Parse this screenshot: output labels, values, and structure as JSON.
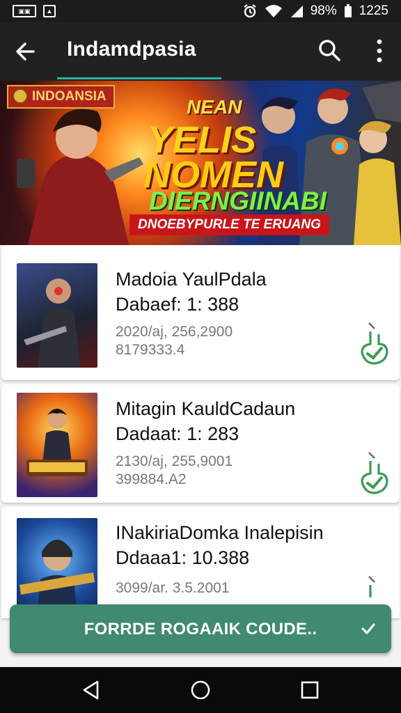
{
  "status_bar": {
    "left_icons": [
      "gallery-icon",
      "notification-icon"
    ],
    "left_icon_text": "▣▣",
    "battery": "98%",
    "time": "1225",
    "right_icons": [
      "alarm-icon",
      "wifi-icon",
      "signal-icon",
      "battery-icon"
    ]
  },
  "app_bar": {
    "title": "Indamdpasia",
    "icons": [
      "back-arrow-icon",
      "search-icon",
      "more-vert-icon"
    ],
    "accent_color": "#2bb0a4"
  },
  "banner": {
    "tag": "INDOANSIA",
    "line1": "NEAN",
    "line2": "YELIS",
    "line3": "NOMEN",
    "line4": "DIERNGIINABI",
    "line5": "DNOEBYPURLE TE ERUANG"
  },
  "items": [
    {
      "name": "Madoia YaulPdala",
      "detail": "Dabaef: 1: 388",
      "meta1": "2020/aj, 256,2900",
      "meta2": "8179333.4"
    },
    {
      "name": "Mitagin KauldCadaun",
      "detail": "Dadaat: 1: 283",
      "meta1": "2130/aj, 255,9001",
      "meta2": "399884.A2"
    },
    {
      "name": "INakiriaDomka Inalepisin",
      "detail": "Ddaaa1: 10.388",
      "meta1": "3099/ar. 3.5.2001",
      "meta2": ""
    }
  ],
  "cta": {
    "label": "FORRDE ROGAAIK COUDE..",
    "color": "#3f8a70"
  },
  "nav_bar": {
    "icons": [
      "nav-back-icon",
      "nav-home-icon",
      "nav-recents-icon"
    ]
  }
}
